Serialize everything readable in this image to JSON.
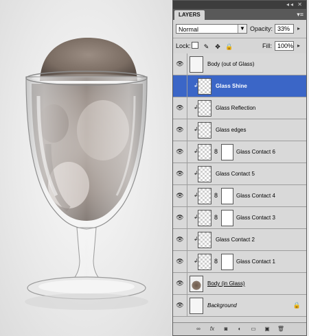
{
  "panel": {
    "title": "LAYERS",
    "blend_mode": "Normal",
    "opacity_label": "Opacity:",
    "opacity_value": "33%",
    "lock_label": "Lock:",
    "fill_label": "Fill:",
    "fill_value": "100%"
  },
  "layers": [
    {
      "name": "Body (out of Glass)"
    },
    {
      "name": "Glass Shine"
    },
    {
      "name": "Glass Reflection"
    },
    {
      "name": "Glass edges"
    },
    {
      "name": "Glass Contact 6"
    },
    {
      "name": "Glass Contact 5"
    },
    {
      "name": "Glass Contact 4"
    },
    {
      "name": "Glass Contact 3"
    },
    {
      "name": "Glass Contact 2"
    },
    {
      "name": "Glass Contact 1"
    },
    {
      "name": "Body (in Glass)"
    },
    {
      "name": "Background"
    }
  ],
  "selected_layer": "Glass Shine",
  "icons": {
    "eye": "eye-icon",
    "clip": "clipping-arrow-icon",
    "chain": "link-icon",
    "lock": "lock-icon",
    "footer": [
      "link-layers-icon",
      "fx-icon",
      "add-mask-icon",
      "adjustment-layer-icon",
      "new-group-icon",
      "new-layer-icon",
      "trash-icon"
    ]
  },
  "colors": {
    "selected_row": "#3b66c7",
    "panel_bg": "#d6d6d6",
    "titlebar": "#3d3d3d"
  }
}
